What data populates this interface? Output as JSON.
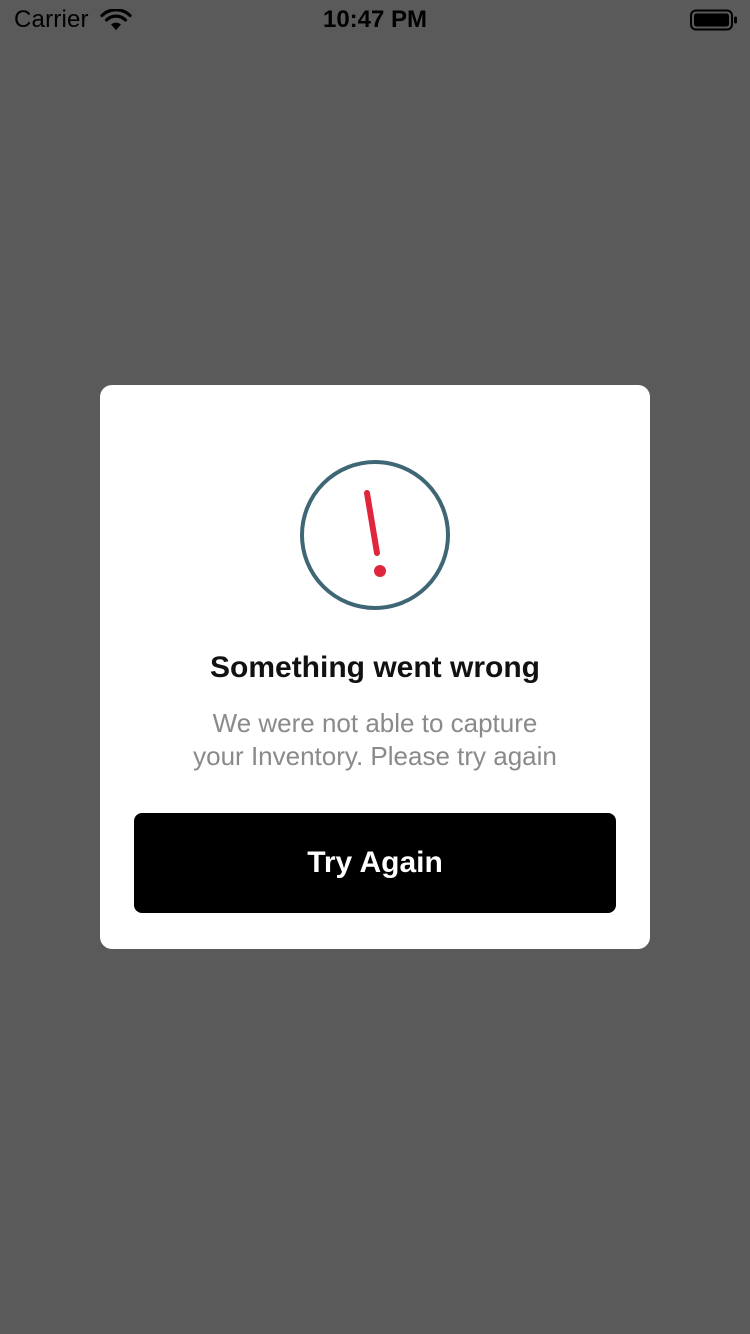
{
  "status_bar": {
    "carrier": "Carrier",
    "time": "10:47 PM",
    "wifi_icon": "wifi-icon",
    "battery_icon": "battery-icon"
  },
  "modal": {
    "icon": "alert-exclamation-icon",
    "title": "Something went wrong",
    "message_line1": "We were not able to capture",
    "message_line2": "your Inventory. Please try again",
    "button_label": "Try Again"
  },
  "colors": {
    "overlay": "#5a5a5a",
    "icon_ring": "#3f6674",
    "icon_mark": "#e0263c",
    "button_bg": "#000000",
    "message_text": "#8a8a8a"
  }
}
